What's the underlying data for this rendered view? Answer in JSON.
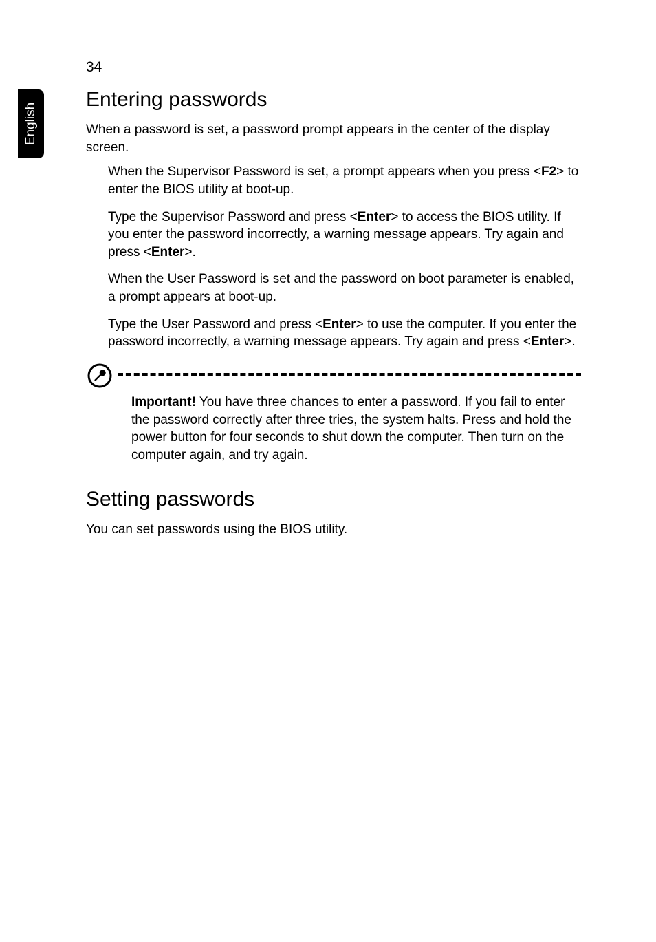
{
  "page_number": "34",
  "side_tab": "English",
  "section1": {
    "heading": "Entering passwords",
    "intro": "When a password is set, a password prompt appears in the center of the display screen.",
    "items": [
      {
        "t1": "When the Supervisor Password is set, a prompt appears when you press <",
        "b1": "F2",
        "t2": "> to enter the BIOS utility at boot-up."
      },
      {
        "t1": "Type the Supervisor Password and press <",
        "b1": "Enter",
        "t2": "> to access the BIOS utility. If you enter the password incorrectly, a warning message appears. Try again and press <",
        "b2": "Enter",
        "t3": ">."
      },
      {
        "t1": "When the User Password is set and the password on boot parameter is enabled, a prompt appears at boot-up."
      },
      {
        "t1": "Type the User Password and press <",
        "b1": "Enter",
        "t2": "> to use the computer. If you enter the password incorrectly, a warning message appears. Try again and press <",
        "b2": "Enter",
        "t3": ">."
      }
    ],
    "note": {
      "lead": "Important!",
      "text": " You have three chances to enter a password. If you fail to enter the password correctly after three tries, the system halts. Press and hold the power button for four seconds to shut down the computer. Then turn on the computer again, and try again."
    }
  },
  "section2": {
    "heading": "Setting passwords",
    "body": "You can set passwords using the BIOS utility."
  }
}
